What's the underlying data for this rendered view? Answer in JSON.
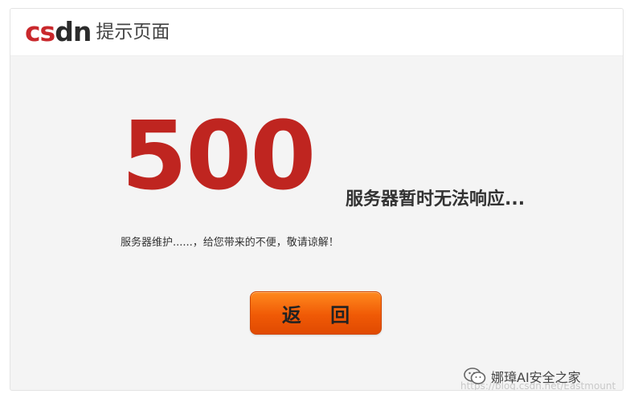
{
  "header": {
    "logo_text": "CSDN",
    "title": "提示页面"
  },
  "error": {
    "code": "500",
    "headline": "服务器暂时无法响应...",
    "description": "服务器维护......，给您带来的不便，敬请谅解！"
  },
  "actions": {
    "back_label": "返 回"
  },
  "watermark": {
    "account": "娜璋AI安全之家",
    "url": "https://blog.csdn.net/Eastmount",
    "icon": "wechat-icon"
  },
  "colors": {
    "brand_red": "#c9282c",
    "code_red": "#bf2520",
    "button_orange": "#f05a06"
  }
}
